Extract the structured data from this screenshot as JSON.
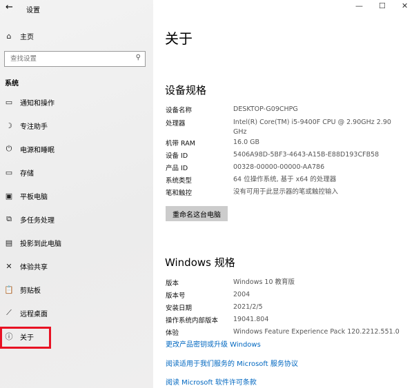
{
  "window": {
    "title": "设置",
    "back_icon": "←",
    "minimize": "—",
    "maximize": "☐",
    "close": "✕"
  },
  "sidebar": {
    "home": "主页",
    "search_placeholder": "查找设置",
    "section": "系统",
    "items": [
      {
        "label": "通知和操作",
        "icon": "▭"
      },
      {
        "label": "专注助手",
        "icon": "☽"
      },
      {
        "label": "电源和睡眠",
        "icon": "⏻"
      },
      {
        "label": "存储",
        "icon": "▭"
      },
      {
        "label": "平板电脑",
        "icon": "▣"
      },
      {
        "label": "多任务处理",
        "icon": "⧉"
      },
      {
        "label": "投影到此电脑",
        "icon": "▤"
      },
      {
        "label": "体验共享",
        "icon": "✕"
      },
      {
        "label": "剪贴板",
        "icon": "📋"
      },
      {
        "label": "远程桌面",
        "icon": "⟋"
      },
      {
        "label": "关于",
        "icon": "ⓘ"
      }
    ],
    "highlight_color": "#e81123"
  },
  "main": {
    "title": "关于",
    "device_heading": "设备规格",
    "device_specs": [
      {
        "k": "设备名称",
        "v": "DESKTOP-G09CHPG"
      },
      {
        "k": "处理器",
        "v": "Intel(R) Core(TM) i5-9400F CPU @ 2.90GHz   2.90 GHz"
      },
      {
        "k": "机带 RAM",
        "v": "16.0 GB"
      },
      {
        "k": "设备 ID",
        "v": "5406A98D-5BF3-4643-A15B-E88D193CFB58"
      },
      {
        "k": "产品 ID",
        "v": "00328-00000-00000-AA786"
      },
      {
        "k": "系统类型",
        "v": "64 位操作系统, 基于 x64 的处理器"
      },
      {
        "k": "笔和触控",
        "v": "没有可用于此显示器的笔或触控输入"
      }
    ],
    "rename_button": "重命名这台电脑",
    "windows_heading": "Windows 规格",
    "windows_specs": [
      {
        "k": "版本",
        "v": "Windows 10 教育版"
      },
      {
        "k": "版本号",
        "v": "2004"
      },
      {
        "k": "安装日期",
        "v": "2021/2/5"
      },
      {
        "k": "操作系统内部版本",
        "v": "19041.804"
      },
      {
        "k": "体验",
        "v": "Windows Feature Experience Pack 120.2212.551.0"
      }
    ],
    "links": [
      "更改产品密钥或升级 Windows",
      "阅读适用于我们服务的 Microsoft 服务协议",
      "阅读 Microsoft 软件许可条款"
    ]
  }
}
